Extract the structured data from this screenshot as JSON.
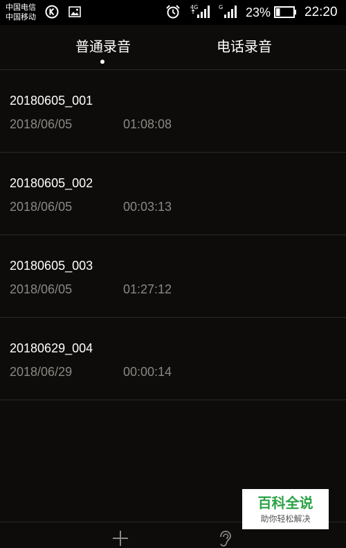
{
  "status_bar": {
    "carrier_1": "中国电信",
    "carrier_2": "中国移动",
    "network_1": "4G",
    "network_2": "G",
    "battery_percent": "23%",
    "battery_level": 0.23,
    "time": "22:20",
    "icons": [
      "k-app-icon",
      "image-icon",
      "alarm-icon",
      "signal-icon",
      "signal-icon",
      "battery-icon"
    ]
  },
  "tabs": [
    {
      "label": "普通录音",
      "selected": true
    },
    {
      "label": "电话录音",
      "selected": false
    }
  ],
  "recordings": [
    {
      "name": "20180605_001",
      "date": "2018/06/05",
      "duration": "01:08:08"
    },
    {
      "name": "20180605_002",
      "date": "2018/06/05",
      "duration": "00:03:13"
    },
    {
      "name": "20180605_003",
      "date": "2018/06/05",
      "duration": "01:27:12"
    },
    {
      "name": "20180629_004",
      "date": "2018/06/29",
      "duration": "00:00:14"
    }
  ],
  "bottom_bar": {
    "icons": [
      "add-icon",
      "ear-icon"
    ]
  },
  "watermark": {
    "title": "百科全说",
    "subtitle": "助你轻松解决"
  },
  "colors": {
    "background": "#0e0c0a",
    "secondary_text": "#8a8784",
    "divider": "#2c2a27",
    "watermark_green": "#2ba245"
  }
}
